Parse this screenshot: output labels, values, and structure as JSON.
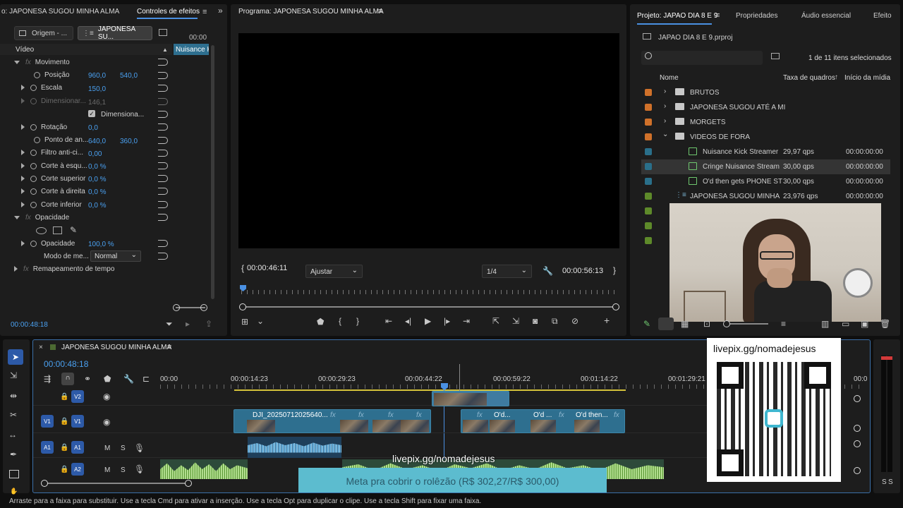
{
  "effect_controls": {
    "tab_source": "o: JAPONESA SUGOU MINHA ALMA",
    "tab_active": "Controles de efeitos",
    "origin_btn": "Origem - ...",
    "seq_btn": "JAPONESA SU...",
    "timecode_small": "00:00",
    "clip_chip": "Nuisance K",
    "video_label": "Vídeo",
    "movement": "Movimento",
    "position": "Posição",
    "position_x": "960,0",
    "position_y": "540,0",
    "scale": "Escala",
    "scale_val": "150,0",
    "dimension_label": "Dimensionar...",
    "dimension_val": "146,1",
    "uniform_label": "Dimensiona...",
    "rotation": "Rotação",
    "rotation_val": "0,0",
    "anchor": "Ponto de an...",
    "anchor_x": "640,0",
    "anchor_y": "360,0",
    "antiflicker": "Filtro anti-ci...",
    "antiflicker_val": "0,00",
    "crop_left": "Corte à esqu...",
    "crop_left_val": "0,0 %",
    "crop_top": "Corte superior",
    "crop_top_val": "0,0 %",
    "crop_right": "Corte à direita",
    "crop_right_val": "0,0 %",
    "crop_bottom": "Corte inferior",
    "crop_bottom_val": "0,0 %",
    "opacity_group": "Opacidade",
    "opacity": "Opacidade",
    "opacity_val": "100,0 %",
    "blend_label": "Modo de me...",
    "blend_val": "Normal",
    "time_remap": "Remapeamento de tempo",
    "timecode": "00:00:48:18"
  },
  "program": {
    "title": "Programa: JAPONESA SUGOU MINHA ALMA",
    "tc_in": "00:00:46:11",
    "fit": "Ajustar",
    "resolution": "1/4",
    "tc_out": "00:00:56:13"
  },
  "project": {
    "tab_project": "Projeto: JAPAO DIA 8 E 9",
    "tab_props": "Propriedades",
    "tab_audio": "Áudio essencial",
    "tab_effects": "Efeito",
    "file": "JAPAO DIA 8 E 9.prproj",
    "selection": "1 de 11 itens selecionados",
    "col_name": "Nome",
    "col_rate": "Taxa de quadros",
    "col_start": "Início da mídia",
    "items": [
      {
        "name": "BRUTOS",
        "rate": "",
        "start": ""
      },
      {
        "name": "JAPONESA SUGOU ATÉ A MI",
        "rate": "",
        "start": ""
      },
      {
        "name": "MORGETS",
        "rate": "",
        "start": ""
      },
      {
        "name": "VIDEOS DE FORA",
        "rate": "",
        "start": ""
      },
      {
        "name": "Nuisance Kick Streamer",
        "rate": "29,97 qps",
        "start": "00:00:00:00"
      },
      {
        "name": "Cringe Nuisance Stream",
        "rate": "30,00 qps",
        "start": "00:00:00:00"
      },
      {
        "name": "O'd then gets PHONE ST",
        "rate": "30,00 qps",
        "start": "00:00:00:00"
      },
      {
        "name": "JAPONESA SUGOU MINHA",
        "rate": "23,976 qps",
        "start": "00:00:00:00"
      }
    ]
  },
  "timeline": {
    "title": "JAPONESA SUGOU MINHA ALMA",
    "timecode": "00:00:48:18",
    "ruler": [
      "00:00",
      "00:00:14:23",
      "00:00:29:23",
      "00:00:44:22",
      "00:00:59:22",
      "00:01:14:22",
      "00:01:29:21",
      "00:0"
    ],
    "tracks": {
      "v2": "V2",
      "v1": "V1",
      "a1": "A1",
      "a2": "A2",
      "m": "M",
      "s": "S"
    },
    "clip_main": "DJI_20250712025640...",
    "clip_od1": "O'd...",
    "clip_od2": "O'd ...",
    "clip_od3": "O'd then...",
    "clip_fx": "fx"
  },
  "overlay": {
    "url_top": "livepix.gg/nomadejesus",
    "url_mid": "livepix.gg/nomadejesus",
    "goal": "Meta pra cobrir o rolêzão (R$ 302,27/R$ 300,00)"
  },
  "meters": {
    "s1": "S",
    "s2": "S"
  },
  "status_bar": "Arraste para a faixa para substituir. Use a tecla Cmd para ativar a inserção. Use a tecla Opt para duplicar o clipe. Use a tecla Shift para fixar uma faixa."
}
